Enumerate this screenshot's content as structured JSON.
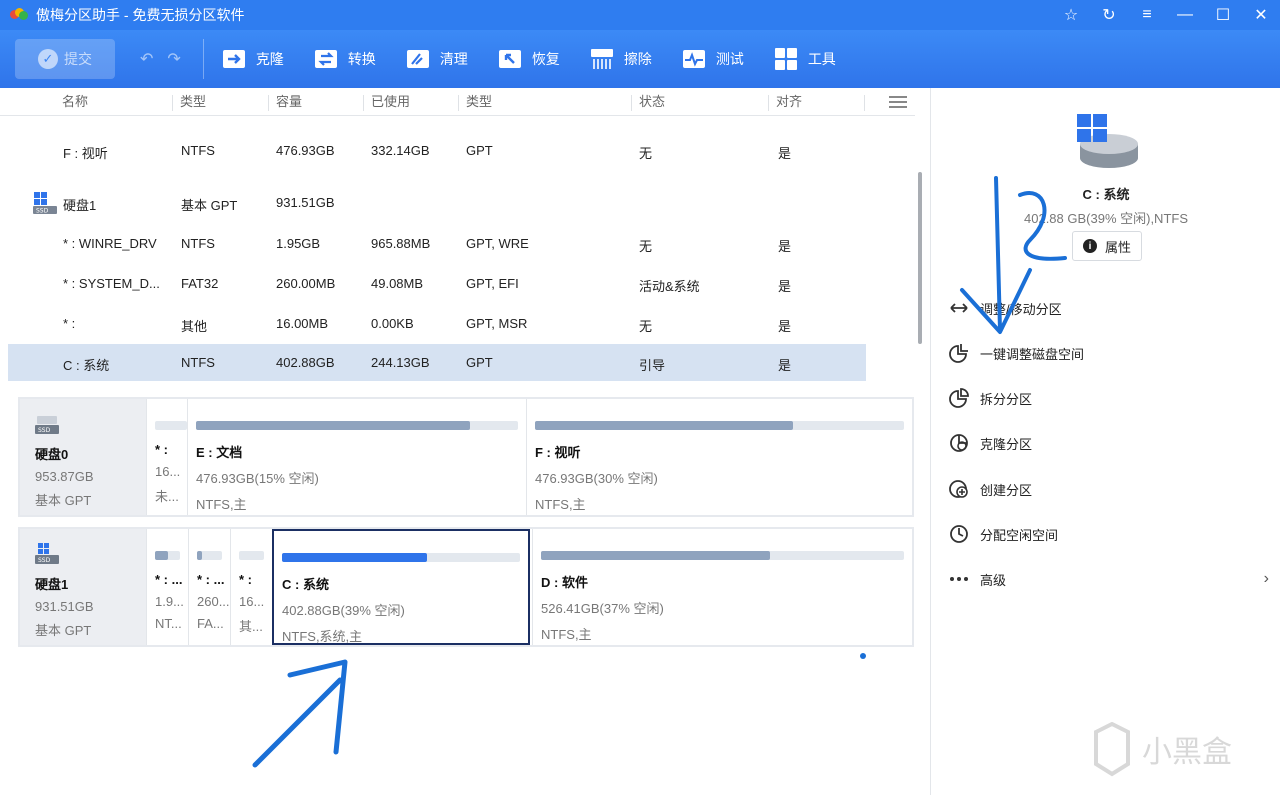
{
  "app": {
    "title": "傲梅分区助手 - 免费无损分区软件"
  },
  "toolbar": {
    "submit_label": "提交",
    "tools": [
      "克隆",
      "转换",
      "清理",
      "恢复",
      "擦除",
      "测试",
      "工具"
    ]
  },
  "table": {
    "headers": [
      "名称",
      "类型",
      "容量",
      "已使用",
      "类型",
      "状态",
      "对齐"
    ],
    "rows": [
      {
        "name": "F : 视听",
        "fs": "NTFS",
        "capacity": "476.93GB",
        "used": "332.14GB",
        "type": "GPT",
        "status": "无",
        "align": "是"
      },
      {
        "name": "硬盘1",
        "fs": "基本 GPT",
        "capacity": "931.51GB",
        "used": "",
        "type": "",
        "status": "",
        "align": "",
        "is_disk": true
      },
      {
        "name": "* : WINRE_DRV",
        "fs": "NTFS",
        "capacity": "1.95GB",
        "used": "965.88MB",
        "type": "GPT, WRE",
        "status": "无",
        "align": "是"
      },
      {
        "name": "* : SYSTEM_D...",
        "fs": "FAT32",
        "capacity": "260.00MB",
        "used": "49.08MB",
        "type": "GPT, EFI",
        "status": "活动&系统",
        "align": "是"
      },
      {
        "name": "* :",
        "fs": "其他",
        "capacity": "16.00MB",
        "used": "0.00KB",
        "type": "GPT, MSR",
        "status": "无",
        "align": "是"
      },
      {
        "name": "C : 系统",
        "fs": "NTFS",
        "capacity": "402.88GB",
        "used": "244.13GB",
        "type": "GPT",
        "status": "引导",
        "align": "是",
        "selected": true
      }
    ]
  },
  "disks": [
    {
      "name": "硬盘0",
      "size": "953.87GB",
      "kind": "基本 GPT",
      "parts": [
        {
          "name": "* :",
          "size": "16...",
          "fs": "未...",
          "used_frac": 0
        },
        {
          "name": "E : 文档",
          "size": "476.93GB(15% 空闲)",
          "fs": "NTFS,主",
          "used_frac": 0.85
        },
        {
          "name": "F : 视听",
          "size": "476.93GB(30% 空闲)",
          "fs": "NTFS,主",
          "used_frac": 0.7
        }
      ]
    },
    {
      "name": "硬盘1",
      "size": "931.51GB",
      "kind": "基本 GPT",
      "parts": [
        {
          "name": "* : ...",
          "size": "1.9...",
          "fs": "NT...",
          "used_frac": 0.5
        },
        {
          "name": "* : ...",
          "size": "260...",
          "fs": "FA...",
          "used_frac": 0.19
        },
        {
          "name": "* :",
          "size": "16...",
          "fs": "其...",
          "used_frac": 0
        },
        {
          "name": "C : 系统",
          "size": "402.88GB(39% 空闲)",
          "fs": "NTFS,系统,主",
          "used_frac": 0.61,
          "active": true
        },
        {
          "name": "D : 软件",
          "size": "526.41GB(37% 空闲)",
          "fs": "NTFS,主",
          "used_frac": 0.63
        }
      ]
    }
  ],
  "panel": {
    "title": "C : 系统",
    "subtitle": "402.88 GB(39% 空闲),NTFS",
    "properties_label": "属性",
    "actions": [
      "调整/移动分区",
      "一键调整磁盘空间",
      "拆分分区",
      "克隆分区",
      "创建分区",
      "分配空闲空间",
      "高级"
    ]
  },
  "watermark": {
    "text": "小黑盒"
  },
  "colors": {
    "accent": "#2f7df0",
    "annotation": "#1a6fd6",
    "selected_row": "#d6e2f2",
    "active_border": "#1b2f63"
  }
}
